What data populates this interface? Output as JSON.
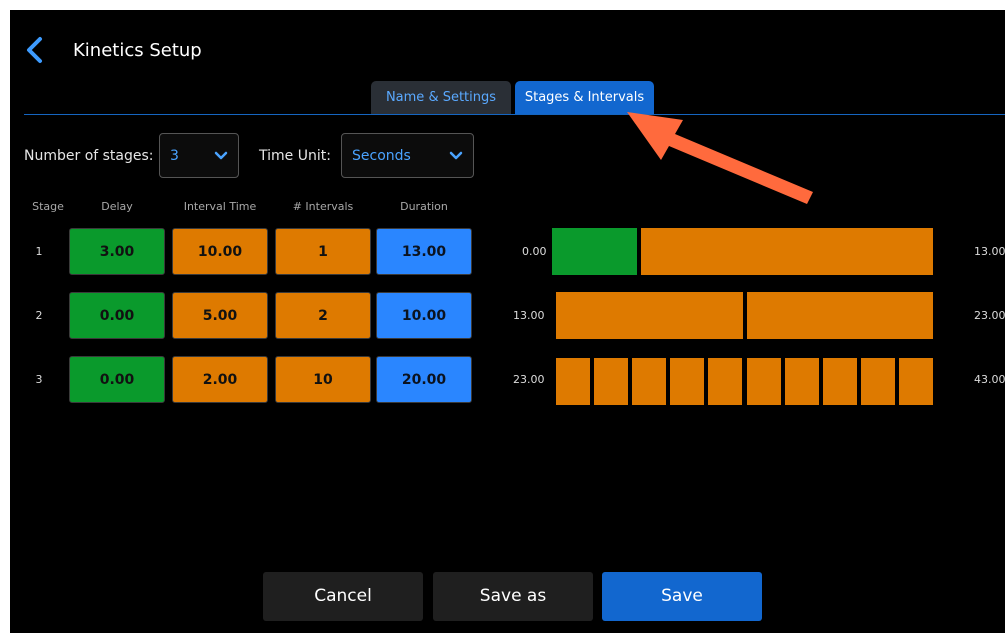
{
  "header": {
    "title": "Kinetics Setup",
    "back_icon": "chevron-left-icon"
  },
  "tabs": [
    {
      "label": "Name & Settings",
      "active": false
    },
    {
      "label": "Stages & Intervals",
      "active": true
    }
  ],
  "controls": {
    "number_of_stages_label": "Number of stages:",
    "number_of_stages_value": "3",
    "time_unit_label": "Time Unit:",
    "time_unit_value": "Seconds"
  },
  "columns": [
    "Stage",
    "Delay",
    "Interval Time",
    "# Intervals",
    "Duration"
  ],
  "stages": [
    {
      "stage": "1",
      "delay": "3.00",
      "interval_time": "10.00",
      "intervals": "1",
      "duration": "13.00",
      "start": "0.00",
      "end": "13.00"
    },
    {
      "stage": "2",
      "delay": "0.00",
      "interval_time": "5.00",
      "intervals": "2",
      "duration": "10.00",
      "start": "13.00",
      "end": "23.00"
    },
    {
      "stage": "3",
      "delay": "0.00",
      "interval_time": "2.00",
      "intervals": "10",
      "duration": "20.00",
      "start": "23.00",
      "end": "43.00"
    }
  ],
  "buttons": {
    "cancel": "Cancel",
    "save_as": "Save as",
    "save": "Save"
  },
  "colors": {
    "delay": "#0a9a2c",
    "interval": "#de7a00",
    "duration": "#2a86ff",
    "accent": "#1267cf",
    "annotation_arrow": "#ff6a3d"
  }
}
